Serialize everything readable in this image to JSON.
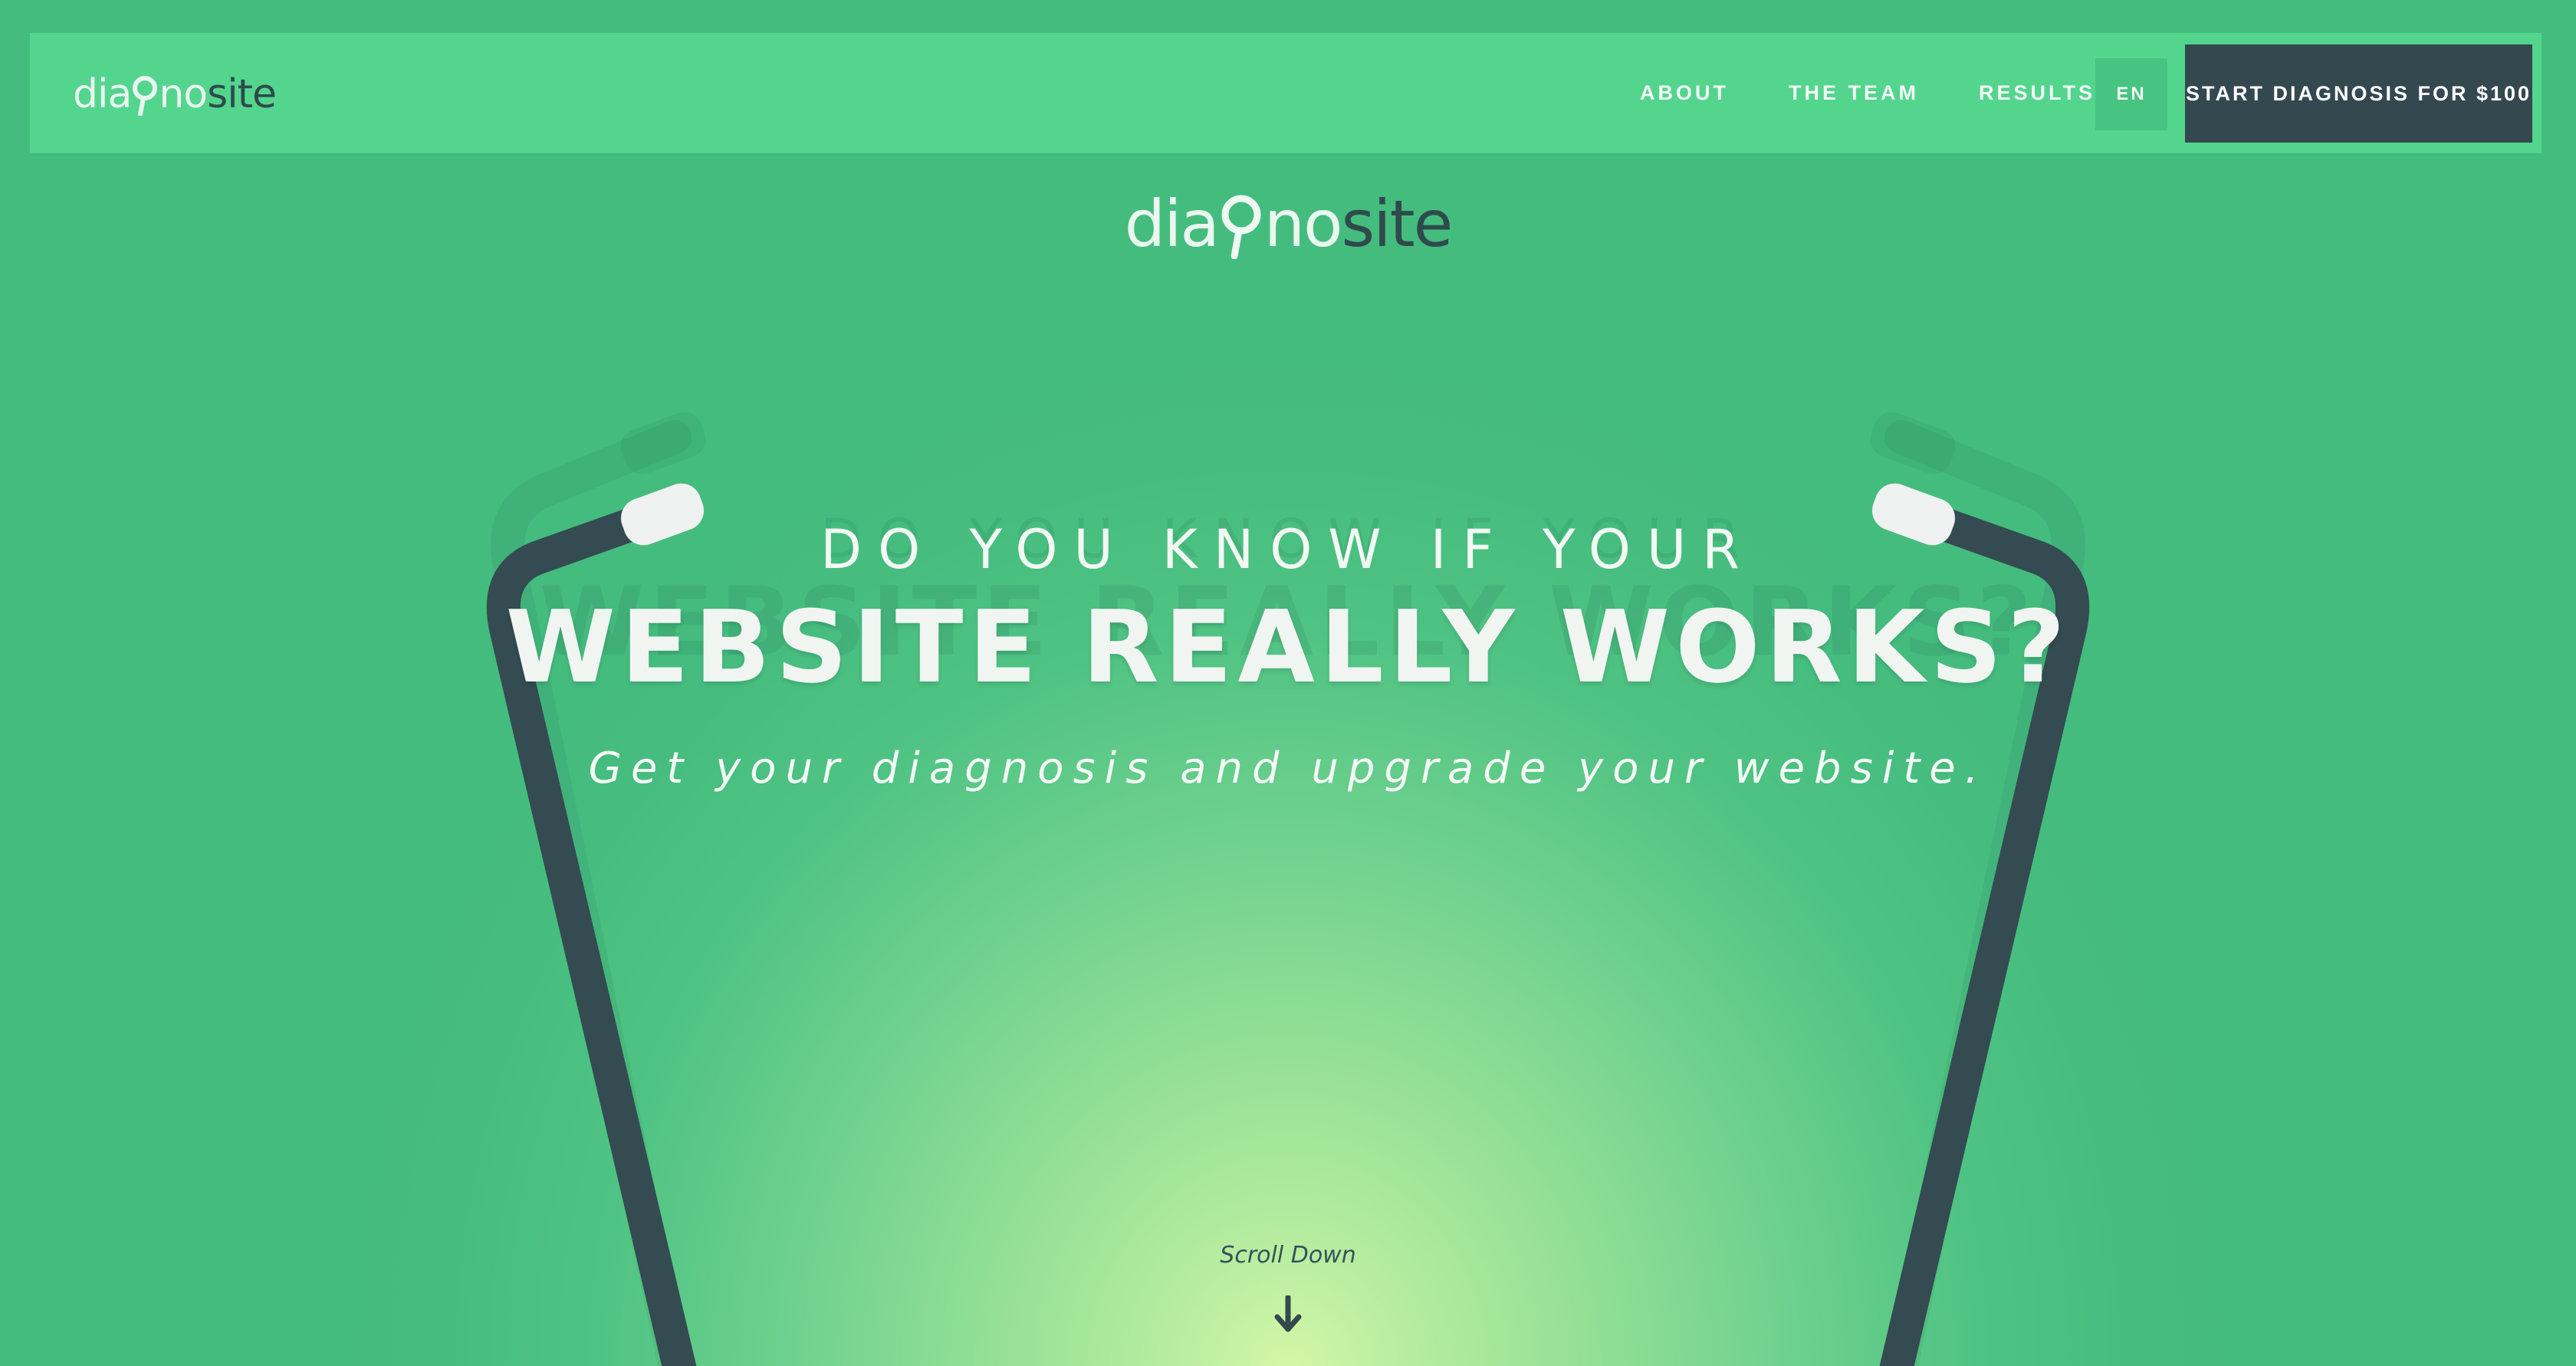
{
  "brand": {
    "logo_prefix": "dia",
    "logo_middle": "no",
    "logo_suffix": "site",
    "colors": {
      "light": "#e9f7ef",
      "dark": "#2f4a4c",
      "nav_bg": "#53d58e",
      "cta_bg": "#34484f",
      "lang_bg": "#47c482"
    }
  },
  "nav": {
    "links": [
      {
        "label": "ABOUT"
      },
      {
        "label": "THE TEAM"
      },
      {
        "label": "RESULTS"
      }
    ],
    "language": "EN",
    "cta_label": "START DIAGNOSIS FOR $100"
  },
  "hero": {
    "headline_small": "DO YOU KNOW IF YOUR",
    "headline_big": "WEBSITE REALLY WORKS?",
    "subheadline": "Get your diagnosis and upgrade your website.",
    "scroll_label": "Scroll Down",
    "scroll_icon": "arrow-down-icon",
    "illustration_icon": "stethoscope-icon"
  }
}
